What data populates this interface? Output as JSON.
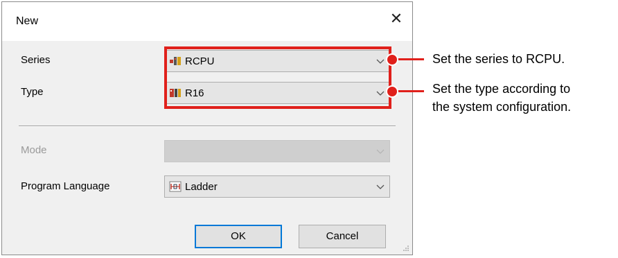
{
  "dialog": {
    "title": "New",
    "close_glyph": "✕"
  },
  "fields": {
    "series": {
      "label": "Series",
      "value": "RCPU",
      "icon": "rcpu-module-icon"
    },
    "type": {
      "label": "Type",
      "value": "R16",
      "icon": "cpu-module-icon"
    },
    "mode": {
      "label": "Mode",
      "value": "",
      "disabled": true
    },
    "language": {
      "label": "Program Language",
      "value": "Ladder",
      "icon": "ladder-icon"
    }
  },
  "buttons": {
    "ok": "OK",
    "cancel": "Cancel"
  },
  "annotations": {
    "series_note": "Set the series to RCPU.",
    "type_note_line1": "Set the type according to",
    "type_note_line2": "the system configuration."
  },
  "colors": {
    "highlight": "#e0201b",
    "default_button_border": "#0078d7",
    "dialog_background": "#f0f0f0"
  }
}
